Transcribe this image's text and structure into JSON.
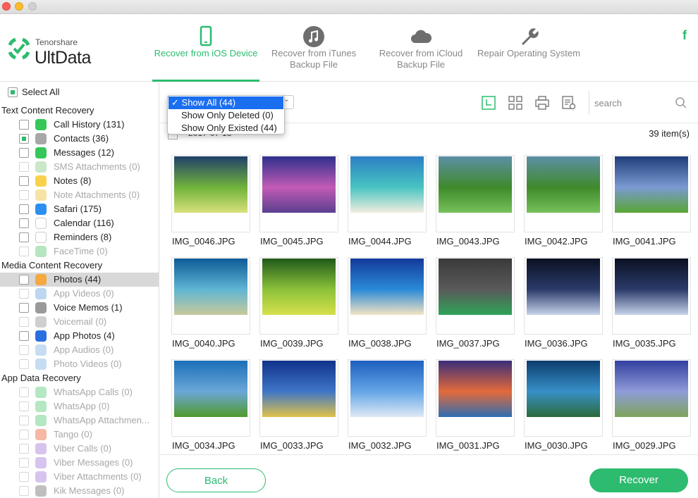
{
  "app": {
    "brand_small": "Tenorshare",
    "brand_name": "UltData"
  },
  "tabs": [
    {
      "label": "Recover from iOS Device",
      "icon": "phone-icon",
      "active": true
    },
    {
      "label": "Recover from iTunes Backup File",
      "icon": "music-note-icon",
      "active": false
    },
    {
      "label": "Recover from iCloud Backup File",
      "icon": "cloud-icon",
      "active": false
    },
    {
      "label": "Repair Operating System",
      "icon": "wrench-icon",
      "active": false
    }
  ],
  "social": {
    "facebook": "f"
  },
  "sidebar": {
    "select_all": "Select All",
    "sections": [
      {
        "title": "Text Content Recovery"
      },
      {
        "title": "Media Content Recovery"
      },
      {
        "title": "App Data Recovery"
      }
    ],
    "items": [
      {
        "label": "Call History (131)",
        "icon": "phone-icon",
        "color": "#35c759",
        "checked": false,
        "enabled": true
      },
      {
        "label": "Contacts (36)",
        "icon": "contacts-icon",
        "color": "#a7a7a7",
        "checked": true,
        "enabled": true
      },
      {
        "label": "Messages (12)",
        "icon": "messages-icon",
        "color": "#35c759",
        "checked": false,
        "enabled": true
      },
      {
        "label": "SMS Attachments (0)",
        "icon": "sms-attachment-icon",
        "color": "#c9e8c9",
        "checked": false,
        "enabled": false
      },
      {
        "label": "Notes (8)",
        "icon": "notes-icon",
        "color": "#f9d24d",
        "checked": false,
        "enabled": true
      },
      {
        "label": "Note Attachments (0)",
        "icon": "note-attachment-icon",
        "color": "#f6e3a6",
        "checked": false,
        "enabled": false
      },
      {
        "label": "Safari (175)",
        "icon": "safari-icon",
        "color": "#2c8ff0",
        "checked": false,
        "enabled": true
      },
      {
        "label": "Calendar (116)",
        "icon": "calendar-icon",
        "color": "#ffffff",
        "checked": false,
        "enabled": true
      },
      {
        "label": "Reminders (8)",
        "icon": "reminders-icon",
        "color": "#ffffff",
        "checked": false,
        "enabled": true
      },
      {
        "label": "FaceTime (0)",
        "icon": "facetime-icon",
        "color": "#b6e6bf",
        "checked": false,
        "enabled": false
      },
      {
        "label": "Photos (44)",
        "icon": "photos-icon",
        "color": "#f4a941",
        "checked": false,
        "enabled": true,
        "selected": true
      },
      {
        "label": "App Videos (0)",
        "icon": "app-videos-icon",
        "color": "#bcd7ef",
        "checked": false,
        "enabled": false
      },
      {
        "label": "Voice Memos (1)",
        "icon": "voice-memos-icon",
        "color": "#9a9a9a",
        "checked": false,
        "enabled": true
      },
      {
        "label": "Voicemail (0)",
        "icon": "voicemail-icon",
        "color": "#cfcfcf",
        "checked": false,
        "enabled": false
      },
      {
        "label": "App Photos (4)",
        "icon": "app-photos-icon",
        "color": "#2a6fe0",
        "checked": false,
        "enabled": true
      },
      {
        "label": "App Audios (0)",
        "icon": "app-audios-icon",
        "color": "#c6dcf2",
        "checked": false,
        "enabled": false
      },
      {
        "label": "Photo Videos (0)",
        "icon": "photo-videos-icon",
        "color": "#c6dcf2",
        "checked": false,
        "enabled": false
      },
      {
        "label": "WhatsApp Calls (0)",
        "icon": "whatsapp-calls-icon",
        "color": "#b4e7c2",
        "checked": false,
        "enabled": false
      },
      {
        "label": "WhatsApp (0)",
        "icon": "whatsapp-icon",
        "color": "#b4e7c2",
        "checked": false,
        "enabled": false
      },
      {
        "label": "WhatsApp Attachmen...",
        "icon": "whatsapp-attachment-icon",
        "color": "#b4e7c2",
        "checked": false,
        "enabled": false
      },
      {
        "label": "Tango (0)",
        "icon": "tango-icon",
        "color": "#f6b8a4",
        "checked": false,
        "enabled": false
      },
      {
        "label": "Viber Calls (0)",
        "icon": "viber-calls-icon",
        "color": "#d6c4ee",
        "checked": false,
        "enabled": false
      },
      {
        "label": "Viber Messages (0)",
        "icon": "viber-messages-icon",
        "color": "#d6c4ee",
        "checked": false,
        "enabled": false
      },
      {
        "label": "Viber Attachments (0)",
        "icon": "viber-attachments-icon",
        "color": "#d6c4ee",
        "checked": false,
        "enabled": false
      },
      {
        "label": "Kik Messages (0)",
        "icon": "kik-icon",
        "color": "#bfbfbf",
        "checked": false,
        "enabled": false
      }
    ]
  },
  "filter_menu": {
    "options": [
      "Show All (44)",
      "Show Only Deleted (0)",
      "Show Only Existed (44)"
    ],
    "selected": "Show All (44)",
    "check_mark": "✓"
  },
  "toolbar": {
    "icons": [
      "date-view-icon",
      "grid-view-icon",
      "print-icon",
      "export-settings-icon"
    ],
    "search_placeholder": "search"
  },
  "group": {
    "date": "2017-07-13",
    "item_count": "39 item(s)"
  },
  "photos": [
    {
      "name": "IMG_0046.JPG",
      "colors": [
        "#20406a",
        "#6fb33b",
        "#d9e07a"
      ]
    },
    {
      "name": "IMG_0045.JPG",
      "colors": [
        "#2d2f8c",
        "#c25bb6",
        "#5a3f8f"
      ]
    },
    {
      "name": "IMG_0044.JPG",
      "colors": [
        "#2b7fc4",
        "#48c4c1",
        "#f3ede0"
      ]
    },
    {
      "name": "IMG_0043.JPG",
      "colors": [
        "#5d8fa6",
        "#3f8a2b",
        "#76c15a"
      ]
    },
    {
      "name": "IMG_0042.JPG",
      "colors": [
        "#5d8fa6",
        "#3f8a2b",
        "#76c15a"
      ]
    },
    {
      "name": "IMG_0041.JPG",
      "colors": [
        "#1f3d7a",
        "#7a9ad1",
        "#5aa535"
      ]
    },
    {
      "name": "IMG_0040.JPG",
      "colors": [
        "#0d5a96",
        "#5fb6d4",
        "#c7c99a"
      ]
    },
    {
      "name": "IMG_0039.JPG",
      "colors": [
        "#1f5a1a",
        "#8cc23a",
        "#d5e04a"
      ]
    },
    {
      "name": "IMG_0038.JPG",
      "colors": [
        "#123a9a",
        "#2a8ad8",
        "#f3e4c2"
      ]
    },
    {
      "name": "IMG_0037.JPG",
      "colors": [
        "#3a3a3a",
        "#5a5a5a",
        "#2ea358"
      ]
    },
    {
      "name": "IMG_0036.JPG",
      "colors": [
        "#0a1022",
        "#2b3b6b",
        "#c6d3ea"
      ]
    },
    {
      "name": "IMG_0035.JPG",
      "colors": [
        "#0a1022",
        "#2b3b6b",
        "#c6d3ea"
      ]
    },
    {
      "name": "IMG_0034.JPG",
      "colors": [
        "#1b6fb8",
        "#6ba7d8",
        "#4f9a2a"
      ]
    },
    {
      "name": "IMG_0033.JPG",
      "colors": [
        "#10328a",
        "#3f76c6",
        "#e0c24a"
      ]
    },
    {
      "name": "IMG_0032.JPG",
      "colors": [
        "#1e5fbf",
        "#65a6e6",
        "#dfe9f5"
      ]
    },
    {
      "name": "IMG_0031.JPG",
      "colors": [
        "#3a2d7a",
        "#e36a3a",
        "#2d6fb3"
      ]
    },
    {
      "name": "IMG_0030.JPG",
      "colors": [
        "#0c3d6e",
        "#3790c7",
        "#2a6a3a"
      ]
    },
    {
      "name": "IMG_0029.JPG",
      "colors": [
        "#3340a0",
        "#8f9cd8",
        "#7ea45a"
      ]
    }
  ],
  "buttons": {
    "back": "Back",
    "recover": "Recover"
  },
  "colors": {
    "accent": "#2dbb6f",
    "menu_highlight": "#1a6ef0"
  }
}
